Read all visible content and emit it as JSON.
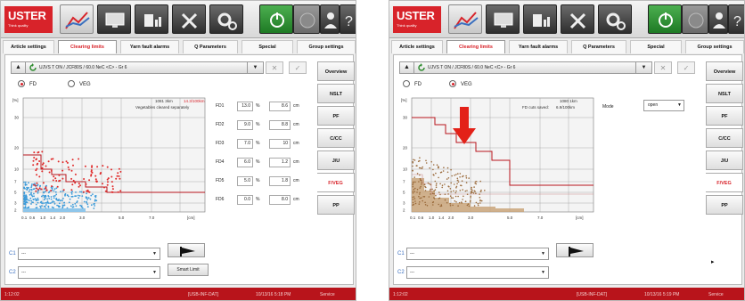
{
  "panels": [
    {
      "id": "left",
      "logo": {
        "main": "USTER",
        "sub": "Think quality"
      },
      "tabs": [
        "Article settings",
        "Clearing limits",
        "Yarn fault alarms",
        "Q Parameters",
        "Special",
        "Group settings"
      ],
      "active_tab": 1,
      "selector": {
        "text": "UJVS T ON / JCF80S / 60.0 NeC <C> - Gr 6"
      },
      "radios": [
        {
          "label": "FD",
          "selected": true
        },
        {
          "label": "VEG",
          "selected": false
        }
      ],
      "chart": {
        "y_unit": "[%]",
        "x_unit": "[cm]",
        "info_count": "1081 3km",
        "info_rate": "14.3/100km",
        "info_text": "Vegetables cleared separately",
        "y_ticks": [
          "30",
          "20",
          "10",
          "7",
          "5",
          "3",
          "2"
        ],
        "x_ticks": [
          "0.1",
          "0.6",
          "1.0",
          "1.4",
          "2.0",
          "3.0",
          "5.0",
          "7.0",
          "[cm]"
        ]
      },
      "fd_rows": [
        {
          "label": "FD1",
          "pct": "13.0",
          "cm": "8.6"
        },
        {
          "label": "FD2",
          "pct": "9.0",
          "cm": "8.8"
        },
        {
          "label": "FD3",
          "pct": "7.0",
          "cm": "10"
        },
        {
          "label": "FD4",
          "pct": "6.0",
          "cm": "1.2"
        },
        {
          "label": "FD5",
          "pct": "5.0",
          "cm": "1.8"
        },
        {
          "label": "FD6",
          "pct": "0.0",
          "cm": "8.0"
        }
      ],
      "units": {
        "pct": "%",
        "cm": "cm"
      },
      "side_buttons": [
        "Overview",
        "NSLT",
        "PF",
        "C/CC",
        "J/U",
        "F/VEG",
        "PP"
      ],
      "active_side": 5,
      "channels": [
        {
          "label": "C1",
          "value": "---"
        },
        {
          "label": "C2",
          "value": "---"
        }
      ],
      "smart_limit": "Smart Limit",
      "status": {
        "time": "1:12:02",
        "job": "[USB-INF-DAT]",
        "datetime": "10/13/16 5:18 PM",
        "service": "Service"
      }
    },
    {
      "id": "right",
      "logo": {
        "main": "USTER",
        "sub": "Think quality"
      },
      "tabs": [
        "Article settings",
        "Clearing limits",
        "Yarn fault alarms",
        "Q Parameters",
        "Special",
        "Group settings"
      ],
      "active_tab": 1,
      "selector": {
        "text": "UJVS T ON / JCF80S / 60.0 NeC <C> - Gr 6"
      },
      "radios": [
        {
          "label": "FD",
          "selected": false
        },
        {
          "label": "VEG",
          "selected": true
        }
      ],
      "chart": {
        "y_unit": "[%]",
        "x_unit": "[cm]",
        "info_count": "1080 1km",
        "info_text": "FD cuts saved:",
        "info_rate": "6.9/100km",
        "y_ticks": [
          "30",
          "20",
          "10",
          "7",
          "5",
          "3",
          "2"
        ],
        "x_ticks": [
          "0.1",
          "0.6",
          "1.0",
          "1.4",
          "2.0",
          "3.0",
          "5.0",
          "7.0",
          "[cm]"
        ]
      },
      "mode": {
        "label": "Mode",
        "value": "open"
      },
      "side_buttons": [
        "Overview",
        "NSLT",
        "PF",
        "C/CC",
        "J/U",
        "F/VEG",
        "PP"
      ],
      "active_side": 5,
      "channels": [
        {
          "label": "C1",
          "value": "---"
        },
        {
          "label": "C2",
          "value": "---"
        }
      ],
      "status": {
        "time": "1:12:02",
        "job": "[USB-INF-DAT]",
        "datetime": "10/13/16 5:19 PM",
        "service": "Service"
      }
    }
  ],
  "colors": {
    "brand_red": "#d8232a",
    "status_red": "#b8141b",
    "fd_points": "#e02a2a",
    "veg_points": "#3a9ad9",
    "tan_points": "#9a6a3a",
    "tan_fill": "#c9a47a",
    "limit_line": "#b8141b",
    "arrow": "#e32118"
  },
  "icons": [
    "uster-logo",
    "curve-chart-icon",
    "monitor-icon",
    "bar-chart-icon",
    "tools-icon",
    "gears-icon",
    "power-icon",
    "disabled-icon",
    "user-icon",
    "help-icon",
    "refresh-icon",
    "flag-icon",
    "cursor-icon"
  ]
}
